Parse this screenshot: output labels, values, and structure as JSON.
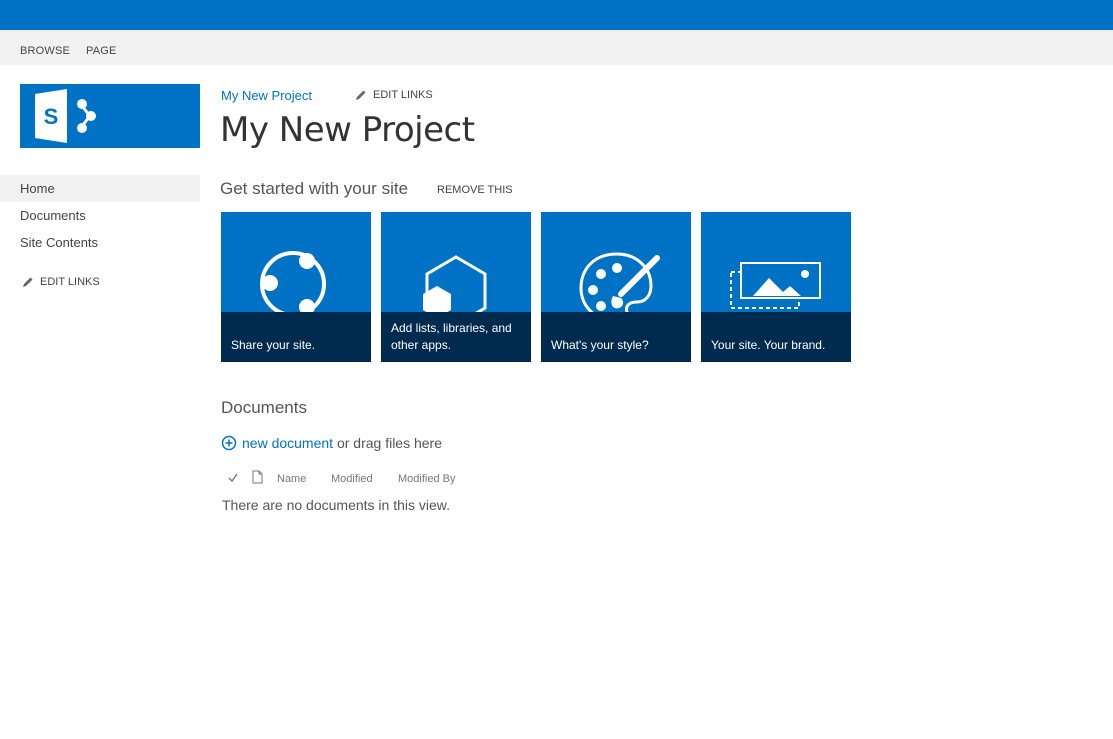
{
  "ribbon": {
    "tabs": [
      {
        "label": "BROWSE"
      },
      {
        "label": "PAGE"
      }
    ]
  },
  "brand": {
    "logo_icon": "sharepoint-logo-icon",
    "accent_color": "#0072c6",
    "tile_caption_color": "#002b4f"
  },
  "quicklaunch": {
    "items": [
      {
        "label": "Home",
        "selected": true
      },
      {
        "label": "Documents"
      },
      {
        "label": "Site Contents"
      }
    ],
    "edit_links": "EDIT LINKS"
  },
  "header": {
    "breadcrumb": "My New Project",
    "edit_links": "EDIT LINKS",
    "title": "My New Project"
  },
  "get_started": {
    "heading": "Get started with your site",
    "remove": "REMOVE THIS",
    "tiles": [
      {
        "caption": "Share your site.",
        "icon": "share-icon"
      },
      {
        "caption": "Add lists, libraries, and other apps.",
        "icon": "apps-icon"
      },
      {
        "caption": "What's your style?",
        "icon": "palette-icon"
      },
      {
        "caption": "Your site. Your brand.",
        "icon": "image-icon"
      }
    ]
  },
  "documents": {
    "heading": "Documents",
    "new_document": "new document",
    "drag_text": "or drag files here",
    "columns": {
      "name": "Name",
      "modified": "Modified",
      "modified_by": "Modified By"
    },
    "empty_message": "There are no documents in this view."
  }
}
